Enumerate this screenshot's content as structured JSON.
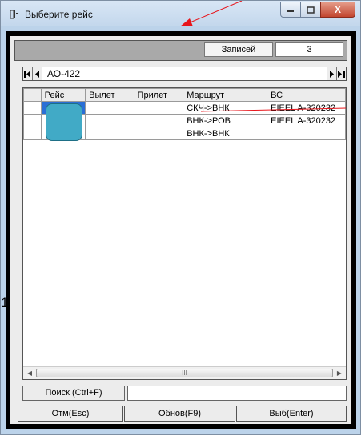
{
  "window": {
    "title": "Выберите рейс",
    "close_glyph": "X",
    "accent": "#e8141a"
  },
  "records": {
    "label": "Записей",
    "value": "3"
  },
  "navigator": {
    "current": "АО-422",
    "icons": [
      "first-record-icon",
      "prev-record-icon",
      "next-record-icon",
      "last-record-icon"
    ]
  },
  "grid": {
    "columns": [
      "",
      "Рейс",
      "Вылет",
      "Прилет",
      "Маршрут",
      "ВС"
    ],
    "rows": [
      [
        "",
        "",
        "",
        "",
        "СКЧ->ВНК",
        "EIEEL A-320232"
      ],
      [
        "",
        "",
        "",
        "",
        "ВНК->РОВ",
        "EIEEL A-320232"
      ],
      [
        "",
        "",
        "",
        "",
        "ВНК->ВНК",
        ""
      ]
    ],
    "scroll_glyph": "III"
  },
  "search": {
    "button_label": "Поиск (Ctrl+F)",
    "value": ""
  },
  "buttons": {
    "cancel": "Отм(Esc)",
    "refresh": "Обнов(F9)",
    "select": "Выб(Enter)"
  },
  "side_number": "1"
}
